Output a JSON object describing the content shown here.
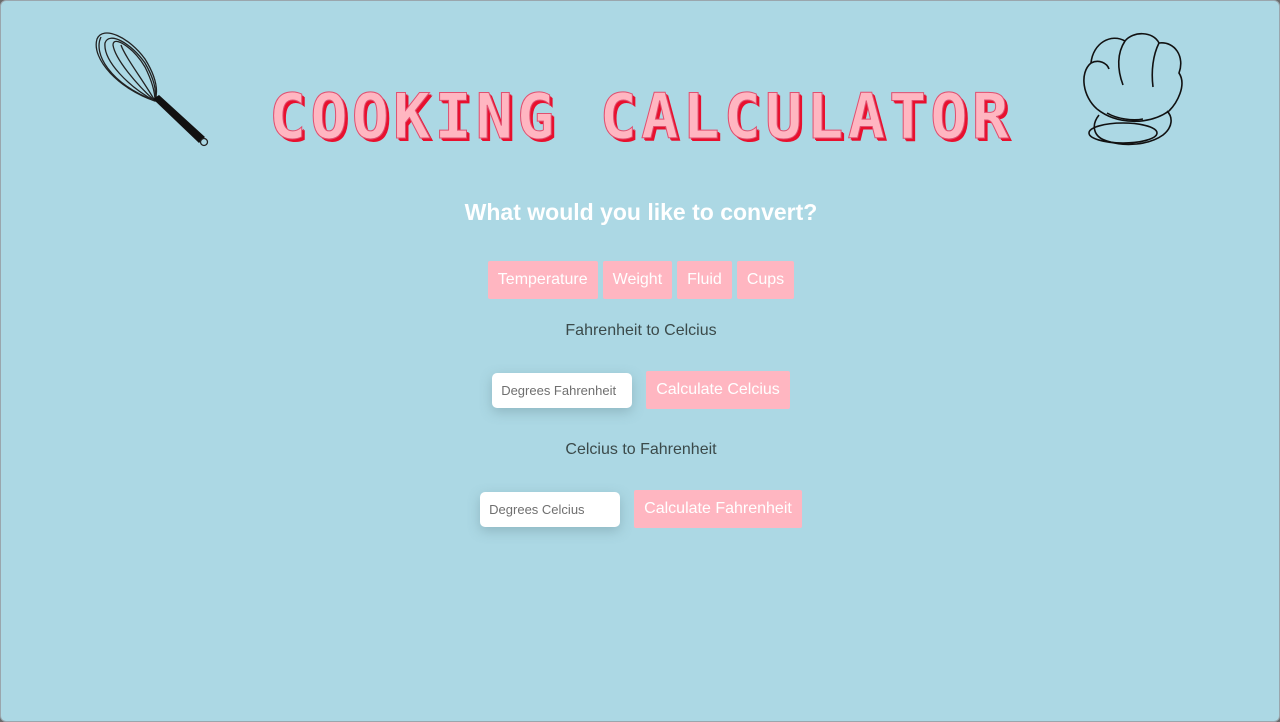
{
  "header": {
    "title": "COOKING CALCULATOR",
    "question": "What would you like to convert?"
  },
  "icons": {
    "left": "whisk-icon",
    "right": "chef-hat-icon"
  },
  "tabs": [
    {
      "label": "Temperature"
    },
    {
      "label": "Weight"
    },
    {
      "label": "Fluid"
    },
    {
      "label": "Cups"
    }
  ],
  "f_to_c": {
    "label": "Fahrenheit to Celcius",
    "placeholder": "Degrees Fahrenheit",
    "value": "",
    "button": "Calculate Celcius"
  },
  "c_to_f": {
    "label": "Celcius to Fahrenheit",
    "placeholder": "Degrees Celcius",
    "value": "",
    "button": "Calculate Fahrenheit"
  },
  "colors": {
    "background": "#acd8e4",
    "accent": "#ffb6c1",
    "title_shadow": "#e8102e",
    "heading_text": "#ffffff",
    "label_text": "#3b4a4a"
  }
}
